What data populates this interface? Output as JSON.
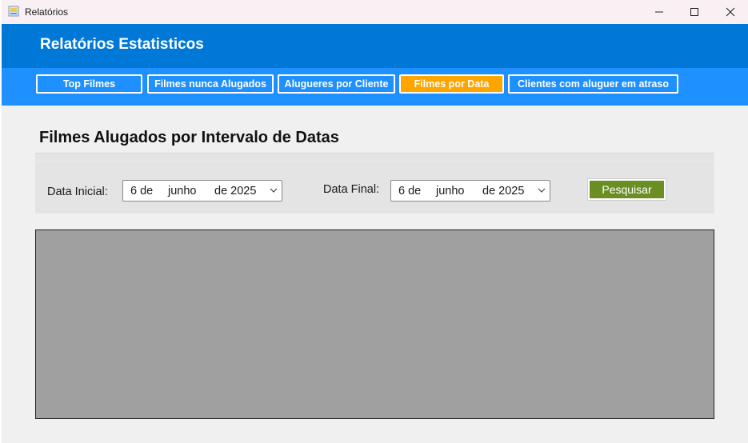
{
  "window": {
    "title": "Relatórios"
  },
  "header": {
    "title": "Relatórios Estatisticos"
  },
  "nav": {
    "items": [
      {
        "label": "Top Filmes"
      },
      {
        "label": "Filmes nunca Alugados"
      },
      {
        "label": "Alugueres por Cliente"
      },
      {
        "label": "Filmes por Data",
        "active": true
      },
      {
        "label": "Clientes com aluguer em atraso"
      }
    ]
  },
  "section": {
    "title": "Filmes Alugados por Intervalo de Datas"
  },
  "filters": {
    "start_label": "Data Inicial:",
    "start_day": "6 de",
    "start_month": "junho",
    "start_year": "de 2025",
    "end_label": "Data Final:",
    "end_day": "6 de",
    "end_month": "junho",
    "end_year": "de 2025",
    "search_label": "Pesquisar"
  },
  "colors": {
    "header_bg": "#0078d7",
    "nav_bg": "#1e90ff",
    "active_tab": "#ffa500",
    "search_button": "#6b8e23",
    "results_bg": "#a0a0a0"
  },
  "icons": {
    "minimize": "minimize-icon",
    "maximize": "maximize-icon",
    "close": "close-icon",
    "dropdown": "chevron-down-icon"
  }
}
